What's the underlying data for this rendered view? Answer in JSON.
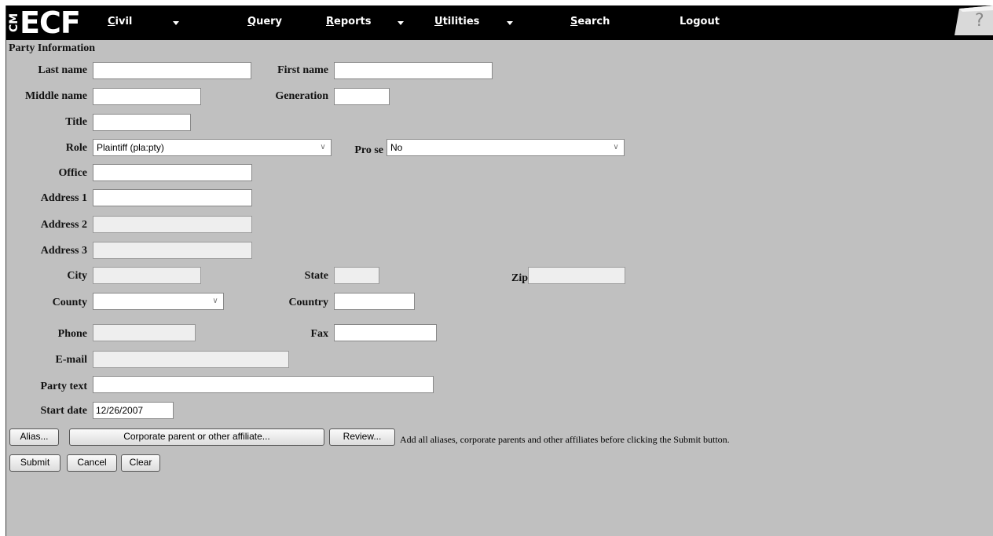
{
  "logo": {
    "cm": "CM",
    "ecf": "ECF"
  },
  "menu": {
    "civil": {
      "first": "C",
      "rest": "ivil"
    },
    "query": {
      "first": "Q",
      "rest": "uery"
    },
    "reports": {
      "first": "R",
      "rest": "eports"
    },
    "utilities": {
      "first": "U",
      "rest": "tilities"
    },
    "search": {
      "first": "S",
      "rest": "earch"
    },
    "logout": {
      "first": "",
      "rest": "Logout"
    }
  },
  "section_title": "Party Information",
  "labels": {
    "last_name": "Last name",
    "first_name": "First name",
    "middle_name": "Middle name",
    "generation": "Generation",
    "title": "Title",
    "role": "Role",
    "pro_se": "Pro se",
    "office": "Office",
    "address1": "Address 1",
    "address2": "Address 2",
    "address3": "Address 3",
    "city": "City",
    "state": "State",
    "zip": "Zip",
    "county": "County",
    "country": "Country",
    "phone": "Phone",
    "fax": "Fax",
    "email": "E-mail",
    "party_text": "Party text",
    "start_date": "Start date"
  },
  "fields": {
    "last_name": "",
    "first_name": "",
    "middle_name": "",
    "generation": "",
    "title": "",
    "role": "Plaintiff (pla:pty)",
    "pro_se": "No",
    "office": "",
    "address1": "",
    "address2": "",
    "address3": "",
    "city": "",
    "state": "",
    "zip": "",
    "county": "",
    "country": "",
    "phone": "",
    "fax": "",
    "email": "",
    "party_text": "",
    "start_date": "12/26/2007"
  },
  "buttons": {
    "alias": "Alias...",
    "corporate_parent": "Corporate parent or other affiliate...",
    "review": "Review...",
    "submit": "Submit",
    "cancel": "Cancel",
    "clear": "Clear"
  },
  "note": "Add all aliases, corporate parents and other affiliates before clicking the Submit button."
}
